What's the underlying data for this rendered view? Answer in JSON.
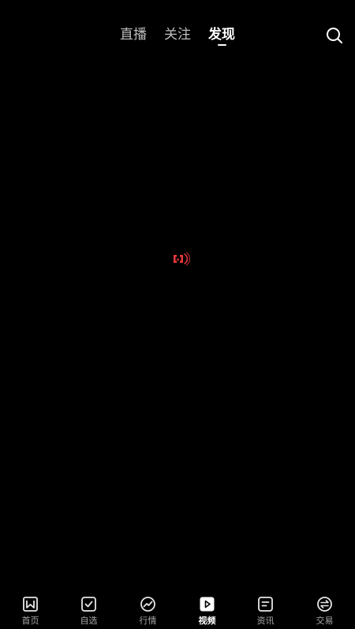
{
  "top_tabs": [
    {
      "label": "直播",
      "active": false
    },
    {
      "label": "关注",
      "active": false
    },
    {
      "label": "发现",
      "active": true
    }
  ],
  "search": {
    "icon": "search-icon"
  },
  "loading": {
    "icon": "loading-spinner-icon",
    "color": "#e8373d"
  },
  "bottom_nav": [
    {
      "label": "首页",
      "icon": "home-icon",
      "active": false
    },
    {
      "label": "自选",
      "icon": "watchlist-icon",
      "active": false
    },
    {
      "label": "行情",
      "icon": "market-icon",
      "active": false
    },
    {
      "label": "视频",
      "icon": "video-icon",
      "active": true
    },
    {
      "label": "资讯",
      "icon": "news-icon",
      "active": false
    },
    {
      "label": "交易",
      "icon": "trade-icon",
      "active": false
    }
  ],
  "colors": {
    "background": "#000000",
    "text_active": "#ffffff",
    "text_inactive": "#bdbdbd",
    "accent_red": "#e8373d"
  }
}
